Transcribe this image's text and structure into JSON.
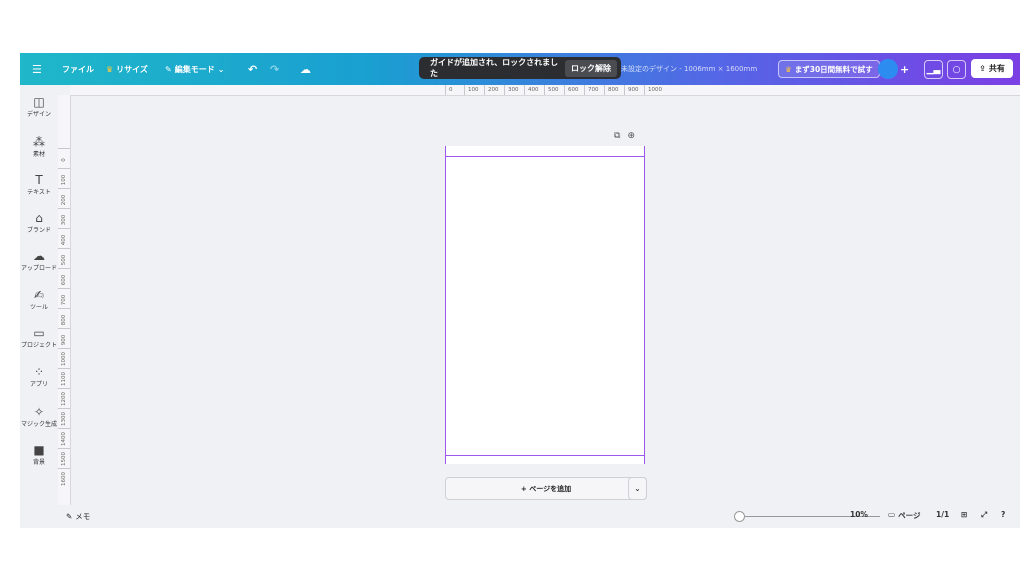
{
  "topbar": {
    "menu_icon": "hamburger-icon",
    "file": "ファイル",
    "resize": "リサイズ",
    "edit_mode": "編集モード",
    "design_title": "未設定のデザイン - 1006mm × 1600mm",
    "trial": "まず30日間無料で試す",
    "share": "共有"
  },
  "toast": {
    "message": "ガイドが追加され、ロックされました",
    "unlock": "ロック解除"
  },
  "sidebar": {
    "items": [
      {
        "label": "デザイン",
        "icon": "layout-icon"
      },
      {
        "label": "素材",
        "icon": "elements-icon"
      },
      {
        "label": "テキスト",
        "icon": "text-icon"
      },
      {
        "label": "ブランド",
        "icon": "brand-icon"
      },
      {
        "label": "アップロード",
        "icon": "upload-icon"
      },
      {
        "label": "ツール",
        "icon": "draw-icon"
      },
      {
        "label": "プロジェクト",
        "icon": "folder-icon"
      },
      {
        "label": "アプリ",
        "icon": "apps-icon"
      },
      {
        "label": "マジック生成",
        "icon": "magic-icon"
      },
      {
        "label": "背景",
        "icon": "background-icon"
      }
    ]
  },
  "rulers": {
    "horizontal": [
      "0",
      "100",
      "200",
      "300",
      "400",
      "500",
      "600",
      "700",
      "800",
      "900",
      "1000"
    ],
    "vertical": [
      "0",
      "100",
      "200",
      "300",
      "400",
      "500",
      "600",
      "700",
      "800",
      "900",
      "1000",
      "1100",
      "1200",
      "1300",
      "1400",
      "1500",
      "1600"
    ]
  },
  "canvas": {
    "add_page": "+ ページを追加"
  },
  "bottom": {
    "memo": "メモ",
    "zoom": "10%",
    "pages_label": "ページ",
    "page_count": "1/1"
  }
}
